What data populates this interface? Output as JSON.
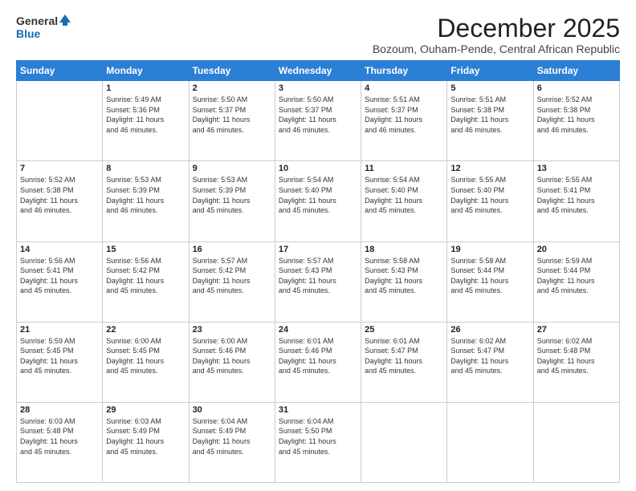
{
  "logo": {
    "general": "General",
    "blue": "Blue"
  },
  "title": "December 2025",
  "location": "Bozoum, Ouham-Pende, Central African Republic",
  "days_of_week": [
    "Sunday",
    "Monday",
    "Tuesday",
    "Wednesday",
    "Thursday",
    "Friday",
    "Saturday"
  ],
  "weeks": [
    [
      {
        "day": "",
        "info": ""
      },
      {
        "day": "1",
        "info": "Sunrise: 5:49 AM\nSunset: 5:36 PM\nDaylight: 11 hours\nand 46 minutes."
      },
      {
        "day": "2",
        "info": "Sunrise: 5:50 AM\nSunset: 5:37 PM\nDaylight: 11 hours\nand 46 minutes."
      },
      {
        "day": "3",
        "info": "Sunrise: 5:50 AM\nSunset: 5:37 PM\nDaylight: 11 hours\nand 46 minutes."
      },
      {
        "day": "4",
        "info": "Sunrise: 5:51 AM\nSunset: 5:37 PM\nDaylight: 11 hours\nand 46 minutes."
      },
      {
        "day": "5",
        "info": "Sunrise: 5:51 AM\nSunset: 5:38 PM\nDaylight: 11 hours\nand 46 minutes."
      },
      {
        "day": "6",
        "info": "Sunrise: 5:52 AM\nSunset: 5:38 PM\nDaylight: 11 hours\nand 46 minutes."
      }
    ],
    [
      {
        "day": "7",
        "info": "Sunrise: 5:52 AM\nSunset: 5:38 PM\nDaylight: 11 hours\nand 46 minutes."
      },
      {
        "day": "8",
        "info": "Sunrise: 5:53 AM\nSunset: 5:39 PM\nDaylight: 11 hours\nand 46 minutes."
      },
      {
        "day": "9",
        "info": "Sunrise: 5:53 AM\nSunset: 5:39 PM\nDaylight: 11 hours\nand 45 minutes."
      },
      {
        "day": "10",
        "info": "Sunrise: 5:54 AM\nSunset: 5:40 PM\nDaylight: 11 hours\nand 45 minutes."
      },
      {
        "day": "11",
        "info": "Sunrise: 5:54 AM\nSunset: 5:40 PM\nDaylight: 11 hours\nand 45 minutes."
      },
      {
        "day": "12",
        "info": "Sunrise: 5:55 AM\nSunset: 5:40 PM\nDaylight: 11 hours\nand 45 minutes."
      },
      {
        "day": "13",
        "info": "Sunrise: 5:55 AM\nSunset: 5:41 PM\nDaylight: 11 hours\nand 45 minutes."
      }
    ],
    [
      {
        "day": "14",
        "info": "Sunrise: 5:56 AM\nSunset: 5:41 PM\nDaylight: 11 hours\nand 45 minutes."
      },
      {
        "day": "15",
        "info": "Sunrise: 5:56 AM\nSunset: 5:42 PM\nDaylight: 11 hours\nand 45 minutes."
      },
      {
        "day": "16",
        "info": "Sunrise: 5:57 AM\nSunset: 5:42 PM\nDaylight: 11 hours\nand 45 minutes."
      },
      {
        "day": "17",
        "info": "Sunrise: 5:57 AM\nSunset: 5:43 PM\nDaylight: 11 hours\nand 45 minutes."
      },
      {
        "day": "18",
        "info": "Sunrise: 5:58 AM\nSunset: 5:43 PM\nDaylight: 11 hours\nand 45 minutes."
      },
      {
        "day": "19",
        "info": "Sunrise: 5:58 AM\nSunset: 5:44 PM\nDaylight: 11 hours\nand 45 minutes."
      },
      {
        "day": "20",
        "info": "Sunrise: 5:59 AM\nSunset: 5:44 PM\nDaylight: 11 hours\nand 45 minutes."
      }
    ],
    [
      {
        "day": "21",
        "info": "Sunrise: 5:59 AM\nSunset: 5:45 PM\nDaylight: 11 hours\nand 45 minutes."
      },
      {
        "day": "22",
        "info": "Sunrise: 6:00 AM\nSunset: 5:45 PM\nDaylight: 11 hours\nand 45 minutes."
      },
      {
        "day": "23",
        "info": "Sunrise: 6:00 AM\nSunset: 5:46 PM\nDaylight: 11 hours\nand 45 minutes."
      },
      {
        "day": "24",
        "info": "Sunrise: 6:01 AM\nSunset: 5:46 PM\nDaylight: 11 hours\nand 45 minutes."
      },
      {
        "day": "25",
        "info": "Sunrise: 6:01 AM\nSunset: 5:47 PM\nDaylight: 11 hours\nand 45 minutes."
      },
      {
        "day": "26",
        "info": "Sunrise: 6:02 AM\nSunset: 5:47 PM\nDaylight: 11 hours\nand 45 minutes."
      },
      {
        "day": "27",
        "info": "Sunrise: 6:02 AM\nSunset: 5:48 PM\nDaylight: 11 hours\nand 45 minutes."
      }
    ],
    [
      {
        "day": "28",
        "info": "Sunrise: 6:03 AM\nSunset: 5:48 PM\nDaylight: 11 hours\nand 45 minutes."
      },
      {
        "day": "29",
        "info": "Sunrise: 6:03 AM\nSunset: 5:49 PM\nDaylight: 11 hours\nand 45 minutes."
      },
      {
        "day": "30",
        "info": "Sunrise: 6:04 AM\nSunset: 5:49 PM\nDaylight: 11 hours\nand 45 minutes."
      },
      {
        "day": "31",
        "info": "Sunrise: 6:04 AM\nSunset: 5:50 PM\nDaylight: 11 hours\nand 45 minutes."
      },
      {
        "day": "",
        "info": ""
      },
      {
        "day": "",
        "info": ""
      },
      {
        "day": "",
        "info": ""
      }
    ]
  ]
}
